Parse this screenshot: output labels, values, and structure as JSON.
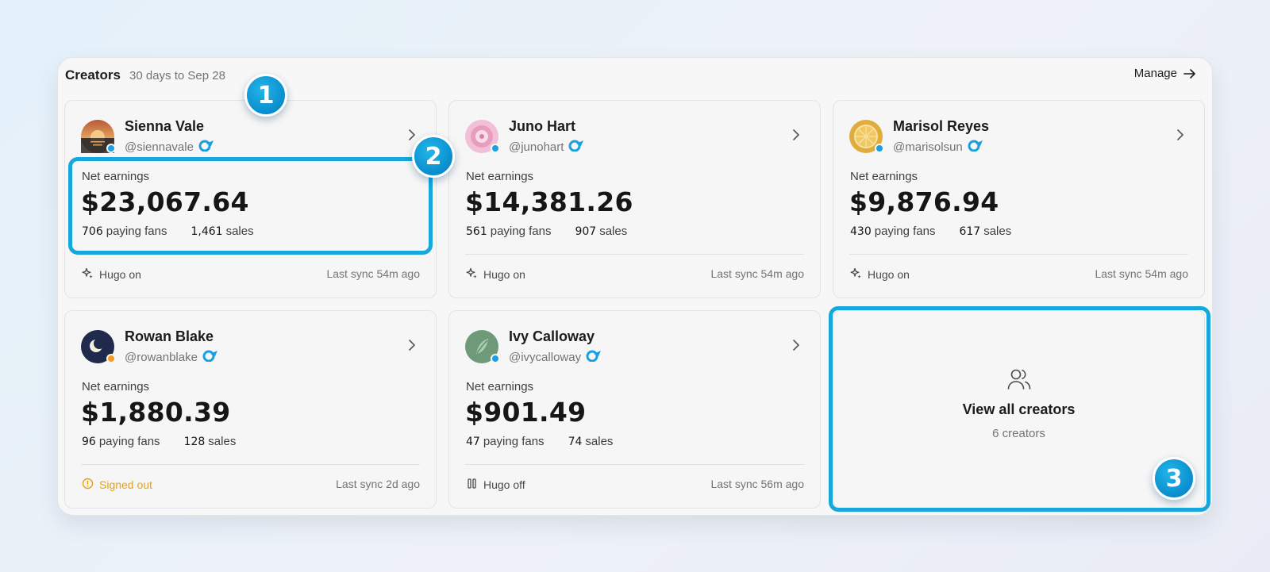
{
  "header": {
    "title": "Creators",
    "subtitle": "30 days to Sep 28",
    "manage_label": "Manage",
    "manage_icon": "arrow-right-icon"
  },
  "labels": {
    "net_earnings": "Net earnings",
    "paying_fans": "paying fans",
    "sales": "sales"
  },
  "creators": [
    {
      "name": "Sienna Vale",
      "handle": "@siennavale",
      "earnings": "$23,067.64",
      "fans": "706",
      "sales": "1,461",
      "status_text": "Hugo on",
      "status_icon": "sparkle-icon",
      "sync": "Last sync 54m ago",
      "dot_color": "#1aa0e0",
      "avatar": "sunset-avatar"
    },
    {
      "name": "Juno Hart",
      "handle": "@junohart",
      "earnings": "$14,381.26",
      "fans": "561",
      "sales": "907",
      "status_text": "Hugo on",
      "status_icon": "sparkle-icon",
      "sync": "Last sync 54m ago",
      "dot_color": "#1aa0e0",
      "avatar": "pink-ring-avatar"
    },
    {
      "name": "Marisol Reyes",
      "handle": "@marisolsun",
      "earnings": "$9,876.94",
      "fans": "430",
      "sales": "617",
      "status_text": "Hugo on",
      "status_icon": "sparkle-icon",
      "sync": "Last sync 54m ago",
      "dot_color": "#1aa0e0",
      "avatar": "citrus-avatar"
    },
    {
      "name": "Rowan Blake",
      "handle": "@rowanblake",
      "earnings": "$1,880.39",
      "fans": "96",
      "sales": "128",
      "status_text": "Signed out",
      "status_icon": "alert-circle-icon",
      "sync": "Last sync 2d ago",
      "dot_color": "#f59a1c",
      "avatar": "moon-avatar"
    },
    {
      "name": "Ivy Calloway",
      "handle": "@ivycalloway",
      "earnings": "$901.49",
      "fans": "47",
      "sales": "74",
      "status_text": "Hugo off",
      "status_icon": "pause-icon",
      "sync": "Last sync 56m ago",
      "dot_color": "#1aa0e0",
      "avatar": "leaf-avatar"
    }
  ],
  "view_all": {
    "title": "View all creators",
    "count": "6 creators",
    "icon": "users-icon"
  },
  "annotations": [
    "1",
    "2",
    "3"
  ],
  "colors": {
    "accent": "#14a8dc",
    "warning": "#e2a416",
    "online": "#1aa0e0",
    "away": "#f59a1c"
  }
}
